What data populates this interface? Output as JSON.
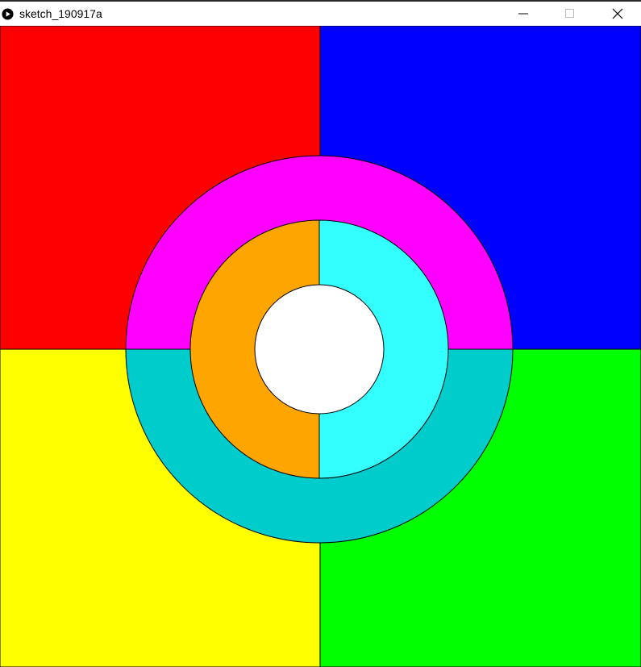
{
  "window": {
    "title": "sketch_190917a",
    "controls": {
      "minimize_icon": "minimize-icon",
      "maximize_icon": "maximize-icon",
      "close_icon": "close-icon"
    },
    "app_icon": "play-circle-icon"
  },
  "sketch": {
    "quadrants": {
      "top_left": "#ff0000",
      "top_right": "#0000ff",
      "bottom_left": "#ffff00",
      "bottom_right": "#00ff00"
    },
    "outer_ring": {
      "top": "#ff00ff",
      "bottom": "#00cccc"
    },
    "middle_ring": {
      "left": "#ffa500",
      "right": "#33ffff"
    },
    "center_circle": "#ffffff",
    "stroke": "#000000"
  }
}
